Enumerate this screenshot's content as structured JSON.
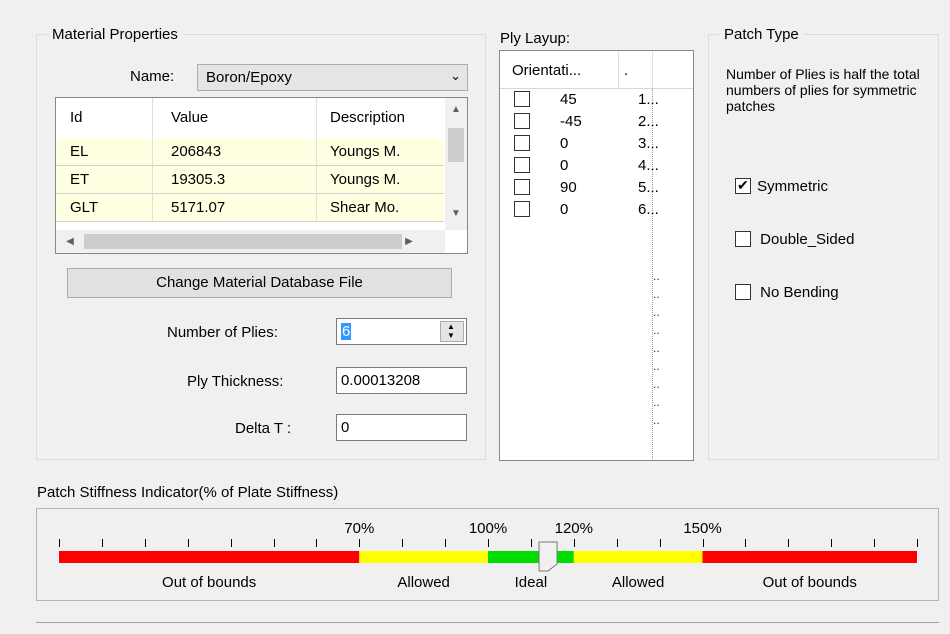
{
  "material": {
    "group_title": "Material Properties",
    "name_label": "Name:",
    "name_value": "Boron/Epoxy",
    "table": {
      "headers": [
        "Id",
        "Value",
        "Description"
      ],
      "rows": [
        [
          "EL",
          "206843",
          "Youngs M."
        ],
        [
          "ET",
          "19305.3",
          "Youngs M."
        ],
        [
          "GLT",
          "5171.07",
          "Shear Mo."
        ]
      ]
    },
    "change_db_button": "Change Material Database File",
    "plies_label": "Number of  Plies:",
    "plies_value": "6",
    "thickness_label": "Ply Thickness:",
    "thickness_value": "0.00013208",
    "delta_label": "Delta T  :",
    "delta_value": "0"
  },
  "layup": {
    "title": "Ply Layup:",
    "headers": [
      "Orientati...",
      "."
    ],
    "rows": [
      {
        "orientation": "45",
        "index": "1..."
      },
      {
        "orientation": "-45",
        "index": "2..."
      },
      {
        "orientation": "0",
        "index": "3..."
      },
      {
        "orientation": "0",
        "index": "4..."
      },
      {
        "orientation": "90",
        "index": "5..."
      },
      {
        "orientation": "0",
        "index": "6..."
      }
    ],
    "filler_dots": [
      "..",
      "..",
      "..",
      "..",
      "..",
      "..",
      "..",
      "..",
      ".."
    ]
  },
  "patch": {
    "group_title": "Patch Type",
    "note": "Number of Plies is half the total numbers of plies for symmetric patches",
    "options": [
      {
        "label": "Symmetric",
        "checked": true
      },
      {
        "label": "Double_Sided",
        "checked": false
      },
      {
        "label": "No Bending",
        "checked": false
      }
    ]
  },
  "stiffness": {
    "title": "Patch Stiffness Indicator(% of Plate Stiffness)",
    "scale_min_pct": 0,
    "scale_max_pct": 200,
    "tick_labels": [
      {
        "text": "70%",
        "pct": 70
      },
      {
        "text": "100%",
        "pct": 100
      },
      {
        "text": "120%",
        "pct": 120
      },
      {
        "text": "150%",
        "pct": 150
      }
    ],
    "zones": [
      {
        "from": 0,
        "to": 70,
        "color": "#ff0000",
        "label": "Out of bounds"
      },
      {
        "from": 70,
        "to": 100,
        "color": "#ffff00",
        "label": "Allowed"
      },
      {
        "from": 100,
        "to": 120,
        "color": "#00dd00",
        "label": "Ideal"
      },
      {
        "from": 120,
        "to": 150,
        "color": "#ffff00",
        "label": "Allowed"
      },
      {
        "from": 150,
        "to": 200,
        "color": "#ff0000",
        "label": "Out of bounds"
      }
    ],
    "indicator_value_pct": 114
  }
}
